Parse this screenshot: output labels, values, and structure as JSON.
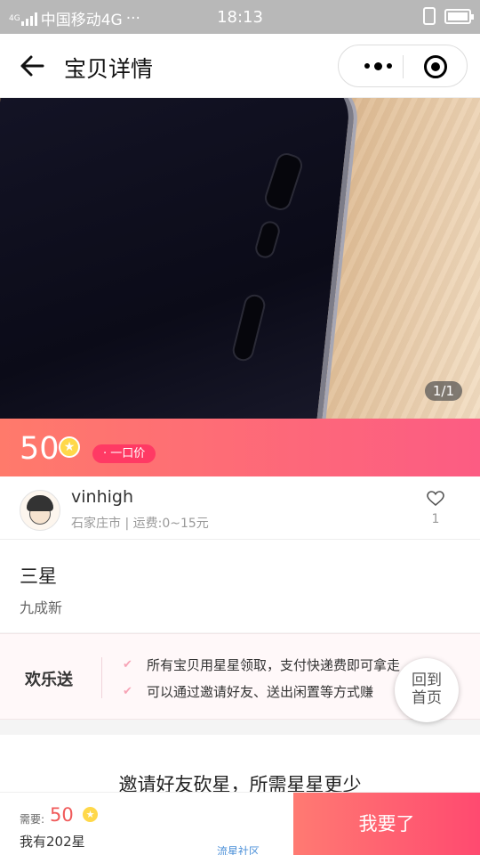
{
  "status_bar": {
    "carrier": "中国移动4G",
    "network_tag": "4G",
    "dots": "···",
    "time": "18:13",
    "icons": [
      "signal-icon",
      "vibrate-icon",
      "battery-icon"
    ]
  },
  "nav": {
    "title": "宝贝详情",
    "icons": [
      "back-arrow-icon",
      "more-dots-icon",
      "target-circle-icon"
    ]
  },
  "gallery": {
    "pager": "1/1"
  },
  "price": {
    "value": "50",
    "tag": "· 一口价",
    "colors": {
      "gradient_start": "#ff7a6b",
      "gradient_end": "#fc5c83",
      "coin": "#ffd84a"
    }
  },
  "seller": {
    "name": "vinhigh",
    "meta": "石家庄市 | 运费:0~15元",
    "likes": "1"
  },
  "item": {
    "title": "三星",
    "condition": "九成新"
  },
  "joy_send": {
    "label": "欢乐送",
    "lines": [
      "所有宝贝用星星领取，支付快递费即可拿走",
      "可以通过邀请好友、送出闲置等方式赚"
    ]
  },
  "home_button": {
    "line1": "回到",
    "line2": "首页"
  },
  "invite": {
    "title": "邀请好友砍星，所需星星更少"
  },
  "bottom_bar": {
    "need_label": "需要:",
    "need_value": "50",
    "have": "我有202星",
    "community": "流星社区",
    "want_button": "我要了"
  }
}
